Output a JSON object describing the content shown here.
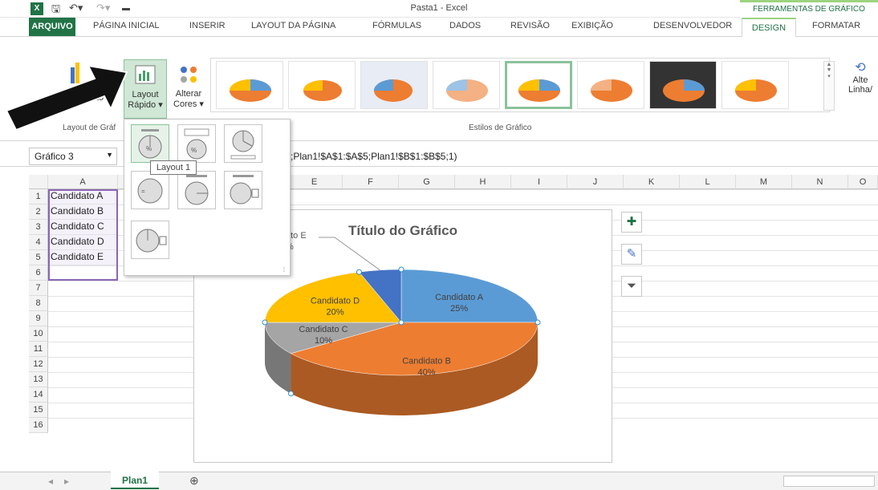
{
  "window": {
    "title": "Pasta1 - Excel",
    "icon": "excel-icon",
    "quick_access": [
      "save-icon",
      "undo-icon",
      "redo-icon",
      "customize-icon"
    ]
  },
  "context_header": "FERRAMENTAS DE GRÁFICO",
  "tabs": [
    {
      "label": "ARQUIVO"
    },
    {
      "label": "PÁGINA INICIAL"
    },
    {
      "label": "INSERIR"
    },
    {
      "label": "LAYOUT DA PÁGINA"
    },
    {
      "label": "FÓRMULAS"
    },
    {
      "label": "DADOS"
    },
    {
      "label": "REVISÃO"
    },
    {
      "label": "EXIBIÇÃO"
    },
    {
      "label": "DESENVOLVEDOR"
    },
    {
      "label": "DESIGN"
    },
    {
      "label": "FORMATAR"
    }
  ],
  "ribbon": {
    "add_element_partial": "to",
    "quick_layout": {
      "line1": "Layout",
      "line2": "Rápido ▾"
    },
    "change_colors": {
      "line1": "Alterar",
      "line2": "Cores ▾"
    },
    "group_layout_label": "Layout de Gráf",
    "group_styles_label": "Estilos de Gráfico",
    "switch_row_col": {
      "line1": "Alte",
      "line2": "Linha/"
    }
  },
  "name_box": "Gráfico 3",
  "formula": "(;Plan1!$A$1:$A$5;Plan1!$B$1:$B$5;1)",
  "columns": [
    "A",
    "B",
    "C",
    "D",
    "E",
    "F",
    "G",
    "H",
    "I",
    "J",
    "K",
    "L",
    "M",
    "N",
    "O"
  ],
  "rows": [
    "1",
    "2",
    "3",
    "4",
    "5",
    "6",
    "7",
    "8",
    "9",
    "10",
    "11",
    "12",
    "13",
    "14",
    "15",
    "16"
  ],
  "cells_a": [
    "Candidato A",
    "Candidato B",
    "Candidato C",
    "Candidato D",
    "Candidato E"
  ],
  "chart": {
    "title": "Título do Gráfico",
    "partial_label": "ato E",
    "partial_pct": "%"
  },
  "chart_data": {
    "type": "pie",
    "title": "Título do Gráfico",
    "categories": [
      "Candidato A",
      "Candidato B",
      "Candidato C",
      "Candidato D",
      "Candidato E"
    ],
    "values": [
      25,
      40,
      10,
      20,
      5
    ],
    "labels": [
      "25%",
      "40%",
      "10%",
      "20%",
      "%"
    ],
    "colors": [
      "#5b9bd5",
      "#ed7d31",
      "#a5a5a5",
      "#ffc000",
      "#4472c4"
    ]
  },
  "dropdown": {
    "tooltip": "Layout 1"
  },
  "sheet": {
    "tab": "Plan1",
    "add": "⊕"
  }
}
